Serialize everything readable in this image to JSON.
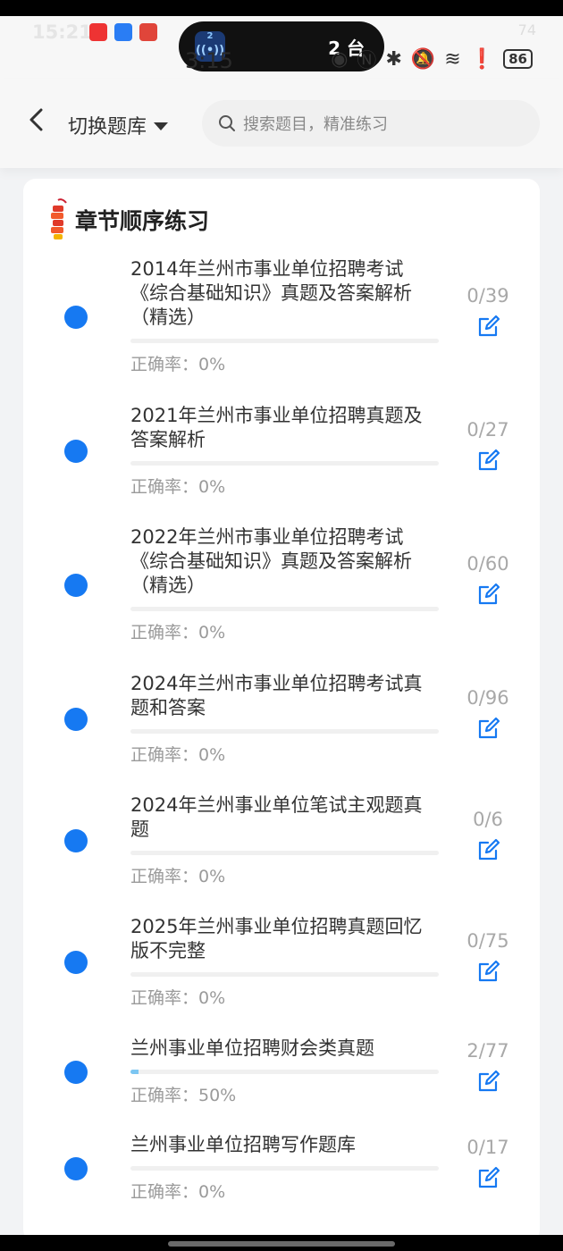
{
  "status": {
    "time_ghost": "15:21",
    "clock": "3:15",
    "island_badge": "2",
    "island_text": "2 台",
    "battery": "86",
    "battery_ghost": "74"
  },
  "nav": {
    "back_icon": "chevron-left-icon",
    "switch_label": "切换题库",
    "search_placeholder": "搜索题目，精准练习"
  },
  "section": {
    "title": "章节顺序练习",
    "icon": "firecracker-icon"
  },
  "chapters": [
    {
      "title": "2014年兰州市事业单位招聘考试《综合基础知识》真题及答案解析（精选）",
      "count": "0/39",
      "accuracy": "正确率：0%",
      "progress": 0
    },
    {
      "title": "2021年兰州市事业单位招聘真题及答案解析",
      "count": "0/27",
      "accuracy": "正确率：0%",
      "progress": 0
    },
    {
      "title": "2022年兰州市事业单位招聘考试《综合基础知识》真题及答案解析（精选）",
      "count": "0/60",
      "accuracy": "正确率：0%",
      "progress": 0
    },
    {
      "title": "2024年兰州市事业单位招聘考试真题和答案",
      "count": "0/96",
      "accuracy": "正确率：0%",
      "progress": 0
    },
    {
      "title": "2024年兰州事业单位笔试主观题真题",
      "count": "0/6",
      "accuracy": "正确率：0%",
      "progress": 0
    },
    {
      "title": "2025年兰州事业单位招聘真题回忆版不完整",
      "count": "0/75",
      "accuracy": "正确率：0%",
      "progress": 0
    },
    {
      "title": "兰州事业单位招聘财会类真题",
      "count": "2/77",
      "accuracy": "正确率：50%",
      "progress": 0.026
    },
    {
      "title": "兰州事业单位招聘写作题库",
      "count": "0/17",
      "accuracy": "正确率：0%",
      "progress": 0
    }
  ],
  "colors": {
    "accent": "#1679f2",
    "progress_fill": "#7cc6f2"
  }
}
